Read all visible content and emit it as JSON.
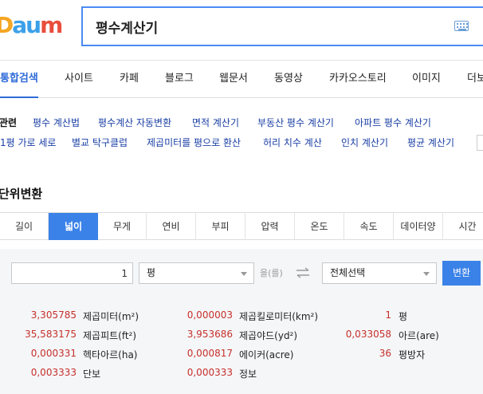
{
  "header": {
    "logo_letters": [
      "D",
      "a",
      "u",
      "m"
    ],
    "logo_colors": [
      "#f5a623",
      "#3ca0e8",
      "#3ca0e8",
      "#e94e3c"
    ],
    "search_value": "평수계산기",
    "keyboard_icon": "keyboard-icon"
  },
  "tabs": [
    "통합검색",
    "사이트",
    "카페",
    "블로그",
    "웹문서",
    "동영상",
    "카카오스토리",
    "이미지",
    "더보"
  ],
  "related": {
    "label": "관련",
    "row1": [
      "평수 계산법",
      "평수계산 자동변환",
      "면적 계산기",
      "부동산 평수 계산기",
      "아파트 평수 계산기"
    ],
    "row2": [
      "1평 가로 세로",
      "별교 탁구클럽",
      "제곱미터를 평으로 환산",
      "허리 치수 계산",
      "인치 계산기",
      "평균 계산기"
    ]
  },
  "converter": {
    "title": "단위변환",
    "unit_tabs": [
      "길이",
      "넓이",
      "무게",
      "연비",
      "부피",
      "압력",
      "온도",
      "속도",
      "데이터양",
      "시간"
    ],
    "active_tab": "넓이",
    "input_value": "1",
    "from_unit": "평",
    "eul_label": "을(를)",
    "to_unit": "전체선택",
    "convert_label": "변환",
    "accent_color": "#3b82e8",
    "results_col1": [
      {
        "value": "3,305785",
        "unit": "제곱미터(m²)"
      },
      {
        "value": "35,583175",
        "unit": "제곱피트(ft²)"
      },
      {
        "value": "0,000331",
        "unit": "헥타아르(ha)"
      },
      {
        "value": "0,003333",
        "unit": "단보"
      }
    ],
    "results_col2": [
      {
        "value": "0,000003",
        "unit": "제곱킬로미터(km²)"
      },
      {
        "value": "3,953686",
        "unit": "제곱야드(yd²)"
      },
      {
        "value": "0,000817",
        "unit": "에이커(acre)"
      },
      {
        "value": "0,000333",
        "unit": "정보"
      }
    ],
    "results_col3": [
      {
        "value": "1",
        "unit": "평"
      },
      {
        "value": "0,033058",
        "unit": "아르(are)"
      },
      {
        "value": "36",
        "unit": "평방자"
      }
    ]
  }
}
